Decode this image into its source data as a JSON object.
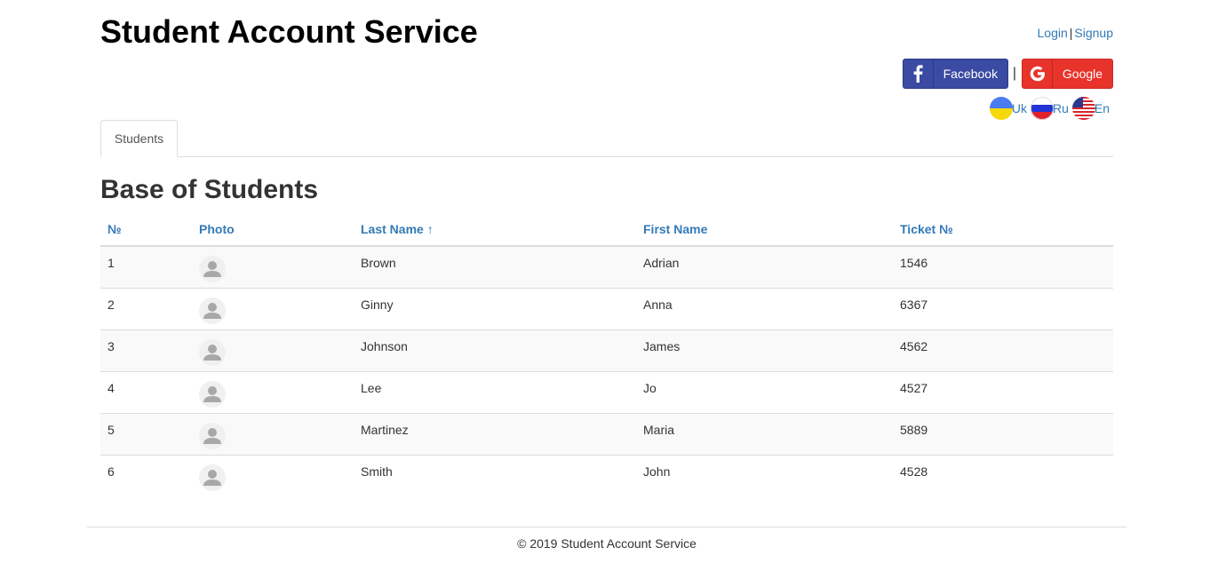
{
  "app": {
    "title": "Student Account Service"
  },
  "auth": {
    "login": "Login",
    "separator": "|",
    "signup": "Signup"
  },
  "social": {
    "facebook": "Facebook",
    "divider": "|",
    "google": "Google",
    "facebook_color": "#3b4aa3",
    "google_color": "#e8332b"
  },
  "languages": [
    {
      "code": "Uk",
      "icon": "ukraine-flag-icon"
    },
    {
      "code": "Ru",
      "icon": "russia-flag-icon"
    },
    {
      "code": "En",
      "icon": "usa-flag-icon"
    }
  ],
  "tabs": [
    {
      "label": "Students"
    }
  ],
  "section": {
    "title": "Base of Students"
  },
  "table": {
    "headers": {
      "number": "№",
      "photo": "Photo",
      "last_name": "Last Name ↑",
      "first_name": "First Name",
      "ticket": "Ticket №"
    },
    "rows": [
      {
        "number": "1",
        "photo": "avatar-placeholder-icon",
        "last_name": "Brown",
        "first_name": "Adrian",
        "ticket": "1546"
      },
      {
        "number": "2",
        "photo": "avatar-placeholder-icon",
        "last_name": "Ginny",
        "first_name": "Anna",
        "ticket": "6367"
      },
      {
        "number": "3",
        "photo": "avatar-placeholder-icon",
        "last_name": "Johnson",
        "first_name": "James",
        "ticket": "4562"
      },
      {
        "number": "4",
        "photo": "avatar-placeholder-icon",
        "last_name": "Lee",
        "first_name": "Jo",
        "ticket": "4527"
      },
      {
        "number": "5",
        "photo": "avatar-placeholder-icon",
        "last_name": "Martinez",
        "first_name": "Maria",
        "ticket": "5889"
      },
      {
        "number": "6",
        "photo": "avatar-placeholder-icon",
        "last_name": "Smith",
        "first_name": "John",
        "ticket": "4528"
      }
    ]
  },
  "footer": {
    "text": "© 2019 Student Account Service"
  },
  "colors": {
    "link": "#337ab7",
    "stripe": "#f9f9f9",
    "border": "#dddddd"
  }
}
